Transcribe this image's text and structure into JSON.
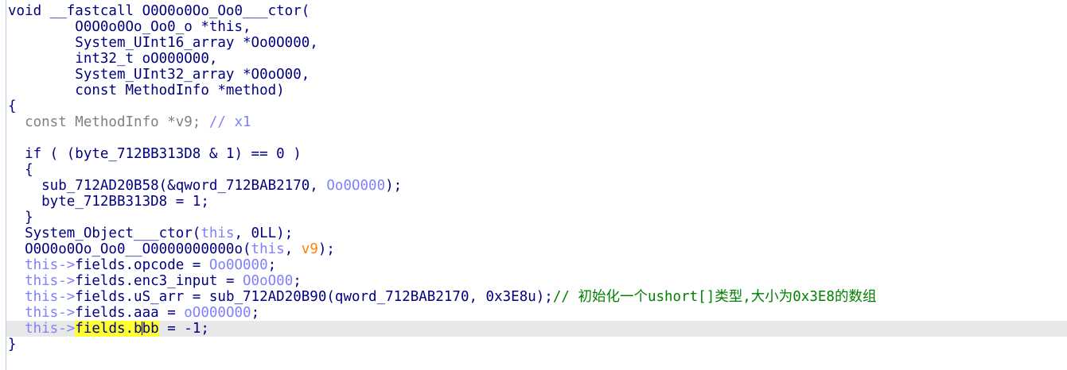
{
  "code": {
    "lines": [
      {
        "current": false,
        "tokens": [
          {
            "text": "void __fastcall O0O0o0Oo_Oo0___ctor(",
            "style": "plain"
          }
        ]
      },
      {
        "current": false,
        "tokens": [
          {
            "text": "        O0O0o0Oo_Oo0_o *this,",
            "style": "plain"
          }
        ]
      },
      {
        "current": false,
        "tokens": [
          {
            "text": "        System_UInt16_array *Oo0O000,",
            "style": "plain"
          }
        ]
      },
      {
        "current": false,
        "tokens": [
          {
            "text": "        int32_t oO000O00,",
            "style": "plain"
          }
        ]
      },
      {
        "current": false,
        "tokens": [
          {
            "text": "        System_UInt32_array *O0oO00,",
            "style": "plain"
          }
        ]
      },
      {
        "current": false,
        "tokens": [
          {
            "text": "        const MethodInfo *method)",
            "style": "plain"
          }
        ]
      },
      {
        "current": false,
        "tokens": [
          {
            "text": "{",
            "style": "plain"
          }
        ]
      },
      {
        "current": false,
        "tokens": [
          {
            "text": "  const MethodInfo ",
            "style": "gray"
          },
          {
            "text": "*v9",
            "style": "gray"
          },
          {
            "text": "; ",
            "style": "gray"
          },
          {
            "text": "// x1",
            "style": "var"
          }
        ]
      },
      {
        "current": false,
        "tokens": [
          {
            "text": "",
            "style": "plain"
          }
        ]
      },
      {
        "current": false,
        "tokens": [
          {
            "text": "  if ( (byte_712BB313D8 & 1) == 0 )",
            "style": "plain"
          }
        ]
      },
      {
        "current": false,
        "tokens": [
          {
            "text": "  {",
            "style": "plain"
          }
        ]
      },
      {
        "current": false,
        "tokens": [
          {
            "text": "    sub_712AD20B58(&qword_712BAB2170, ",
            "style": "plain"
          },
          {
            "text": "Oo0O000",
            "style": "var"
          },
          {
            "text": ");",
            "style": "plain"
          }
        ]
      },
      {
        "current": false,
        "tokens": [
          {
            "text": "    byte_712BB313D8 = 1;",
            "style": "plain"
          }
        ]
      },
      {
        "current": false,
        "tokens": [
          {
            "text": "  }",
            "style": "plain"
          }
        ]
      },
      {
        "current": false,
        "tokens": [
          {
            "text": "  System_Object___ctor(",
            "style": "plain"
          },
          {
            "text": "this",
            "style": "this"
          },
          {
            "text": ", 0LL);",
            "style": "plain"
          }
        ]
      },
      {
        "current": false,
        "tokens": [
          {
            "text": "  O0O0o0Oo_Oo0__O0000000000o(",
            "style": "plain"
          },
          {
            "text": "this",
            "style": "this"
          },
          {
            "text": ", ",
            "style": "plain"
          },
          {
            "text": "v9",
            "style": "v9"
          },
          {
            "text": ");",
            "style": "plain"
          }
        ]
      },
      {
        "current": false,
        "tokens": [
          {
            "text": "  this->",
            "style": "this"
          },
          {
            "text": "fields.opcode = ",
            "style": "plain"
          },
          {
            "text": "Oo0O000",
            "style": "var"
          },
          {
            "text": ";",
            "style": "plain"
          }
        ]
      },
      {
        "current": false,
        "tokens": [
          {
            "text": "  this->",
            "style": "this"
          },
          {
            "text": "fields.enc3_input = ",
            "style": "plain"
          },
          {
            "text": "O0oO00",
            "style": "var"
          },
          {
            "text": ";",
            "style": "plain"
          }
        ]
      },
      {
        "current": false,
        "tokens": [
          {
            "text": "  this->",
            "style": "this"
          },
          {
            "text": "fields.uS_arr = sub_712AD20B90(qword_712BAB2170, 0x3E8u);",
            "style": "plain"
          },
          {
            "text": "// 初始化一个ushort[]类型,大小为0x3E8的数组",
            "style": "comment"
          }
        ]
      },
      {
        "current": false,
        "tokens": [
          {
            "text": "  this->",
            "style": "this"
          },
          {
            "text": "fields.aaa = ",
            "style": "plain"
          },
          {
            "text": "oO000O00",
            "style": "var"
          },
          {
            "text": ";",
            "style": "plain"
          }
        ]
      },
      {
        "current": true,
        "tokens": [
          {
            "text": "  this->",
            "style": "this"
          },
          {
            "text": "fields.b",
            "style": "hl"
          },
          {
            "text": "|",
            "style": "caret"
          },
          {
            "text": "bb",
            "style": "hl"
          },
          {
            "text": " = -1;",
            "style": "plain"
          }
        ]
      },
      {
        "current": false,
        "tokens": [
          {
            "text": "}",
            "style": "plain"
          }
        ]
      }
    ]
  },
  "colors": {
    "plain": "#000080",
    "gray": "#808080",
    "this": "#8080ff",
    "var": "#8080ff",
    "v9": "#ff8000",
    "comment": "#008000",
    "highlight": "#ffff30",
    "current_line": "#e8e8e8"
  }
}
